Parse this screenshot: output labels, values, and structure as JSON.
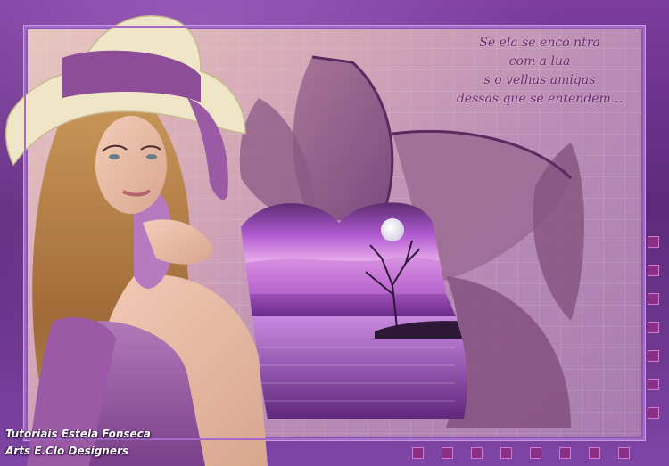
{
  "poem": {
    "lines": [
      "Se ela se enco ntra",
      "com a lua",
      "s   o velhas amigas",
      "dessas  que se entendem..."
    ]
  },
  "credits": {
    "line1": "Tutoriais Estela Fonseca",
    "line2": "Arts E.Clo Designers"
  },
  "colors": {
    "frame_purple": "#6a2f86",
    "poem_text": "#6b2a6e",
    "square_fill": "#8a2f86"
  }
}
